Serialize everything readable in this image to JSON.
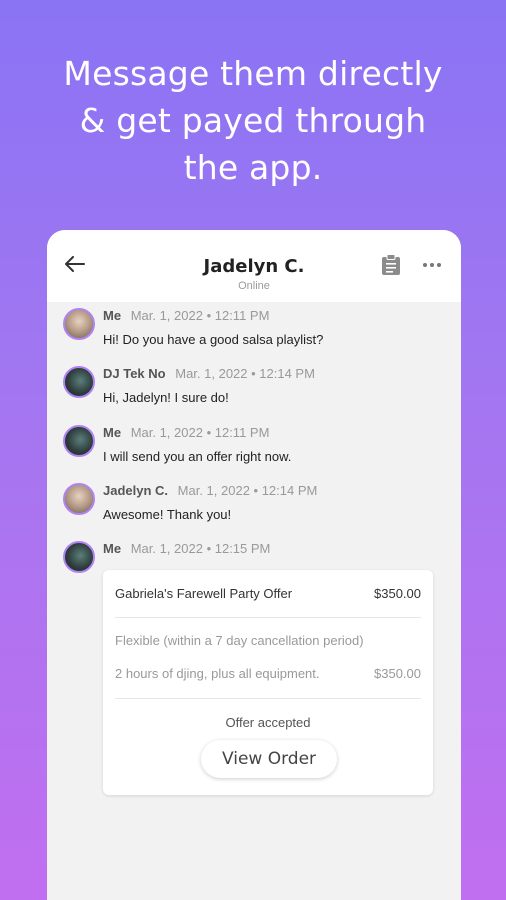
{
  "headline": [
    "Message them directly",
    "& get payed through",
    "the app."
  ],
  "header": {
    "title": "Jadelyn C.",
    "status": "Online"
  },
  "messages": [
    {
      "sender": "Me",
      "timestamp": "Mar. 1, 2022 • 12:11 PM",
      "text": "Hi! Do you have a good salsa playlist?",
      "avatar": "jc"
    },
    {
      "sender": "DJ Tek No",
      "timestamp": "Mar. 1, 2022 • 12:14 PM",
      "text": "Hi, Jadelyn! I sure do!",
      "avatar": "dj"
    },
    {
      "sender": "Me",
      "timestamp": "Mar. 1, 2022 • 12:11 PM",
      "text": "I will send you an offer right now.",
      "avatar": "dj"
    },
    {
      "sender": "Jadelyn C.",
      "timestamp": "Mar. 1, 2022 • 12:14 PM",
      "text": "Awesome! Thank you!",
      "avatar": "jc"
    },
    {
      "sender": "Me",
      "timestamp": "Mar. 1, 2022 • 12:15 PM",
      "text": "",
      "avatar": "dj"
    }
  ],
  "offer": {
    "title": "Gabriela's Farewell Party Offer",
    "price": "$350.00",
    "terms": "Flexible (within a 7 day cancellation period)",
    "item": "2 hours of djing, plus all equipment.",
    "item_price": "$350.00",
    "status": "Offer accepted",
    "button_label": "View Order"
  },
  "colors": {
    "accent": "#b083f5",
    "gradient_top": "#8a74f4",
    "gradient_bottom": "#c06ff0"
  }
}
